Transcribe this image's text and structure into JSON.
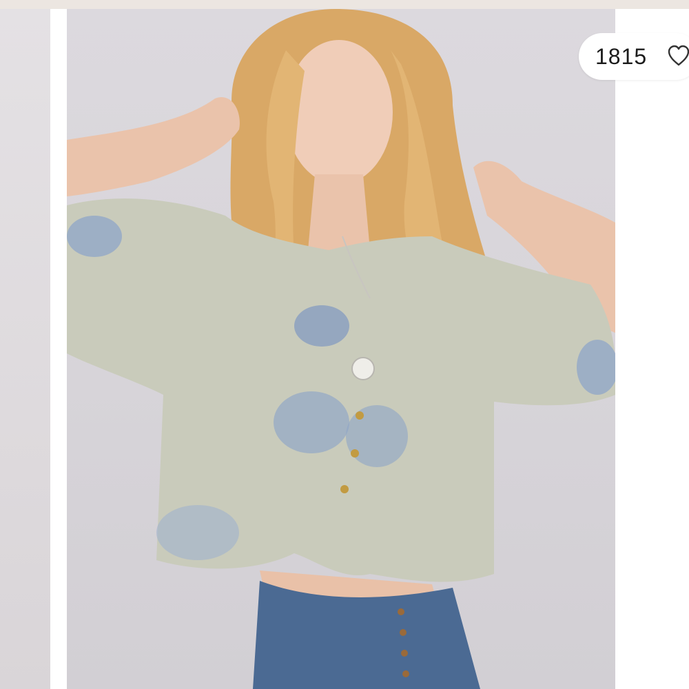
{
  "product_image": {
    "alt": ""
  },
  "like_button": {
    "count": "1815",
    "icon": "heart-outline-icon"
  },
  "colors": {
    "background": "#ffffff",
    "top_strip": "#ece6e1",
    "photo_backdrop": "#d9d6db",
    "pill": "#ffffff",
    "text": "#1b1b1b"
  }
}
